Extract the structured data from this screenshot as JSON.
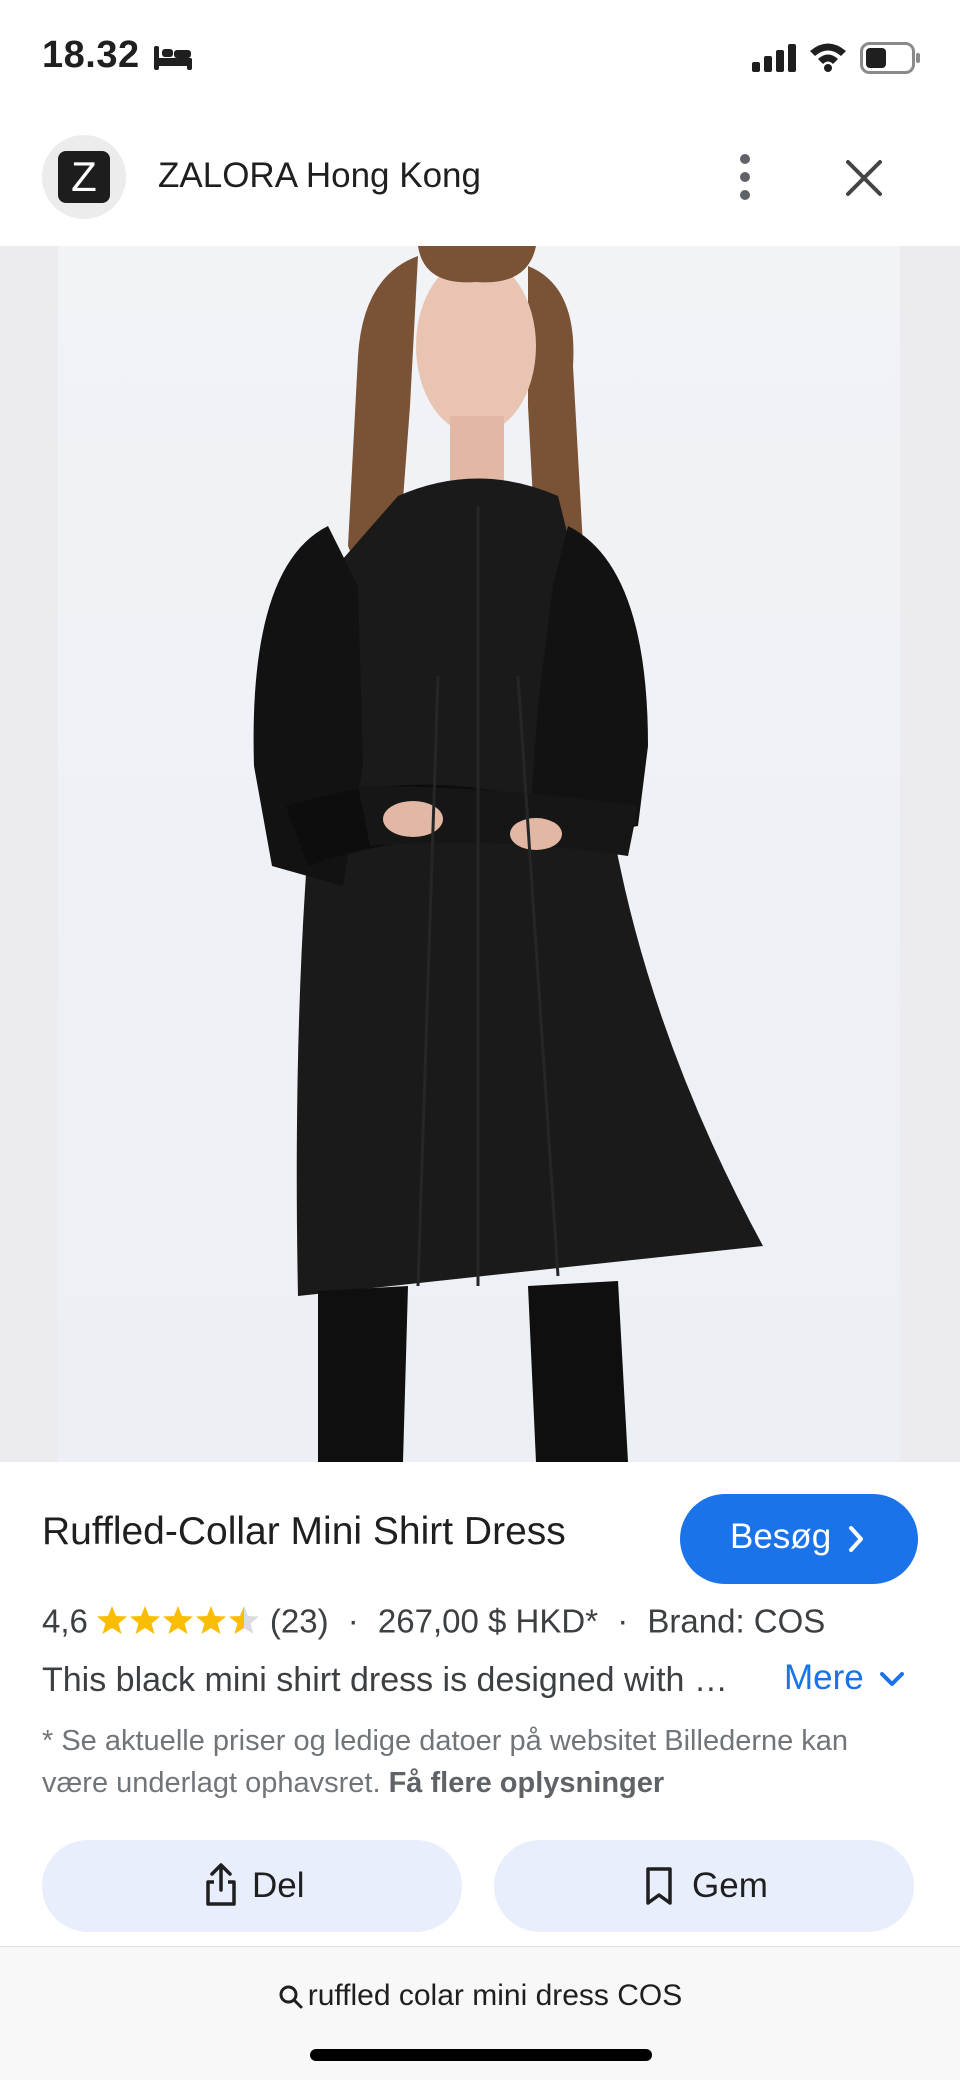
{
  "status_bar": {
    "time": "18.32"
  },
  "header": {
    "site_name": "ZALORA Hong Kong",
    "logo_letter": "Z"
  },
  "product": {
    "title": "Ruffled-Collar Mini Shirt Dress",
    "visit_label": "Besøg",
    "rating": "4,6",
    "rating_stars": 4.5,
    "reviews": "(23)",
    "separator": "·",
    "price": "267,00 $ HKD*",
    "brand": "Brand: COS",
    "description": "This black mini shirt dress is designed with …",
    "more_label": "Mere",
    "disclaimer_text": "* Se aktuelle priser og ledige datoer på websitet Billederne kan være underlagt ophavsret.",
    "disclaimer_link": "Få flere oplysninger"
  },
  "actions": {
    "share_label": "Del",
    "save_label": "Gem"
  },
  "search": {
    "query": "ruffled colar mini dress COS"
  },
  "colors": {
    "accent": "#1a73e8",
    "star": "#fbbc04",
    "button_bg": "#e8eefc"
  }
}
